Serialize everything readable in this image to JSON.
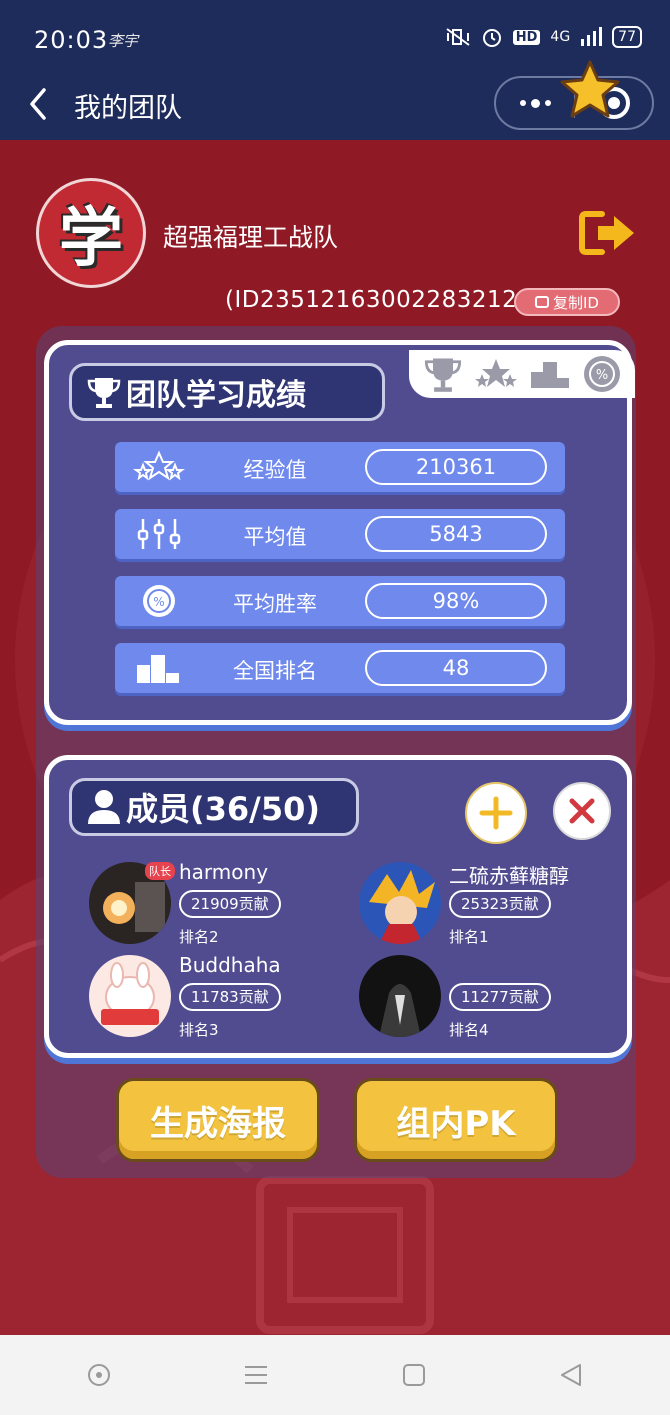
{
  "status_bar": {
    "time": "20:03",
    "signature": "李宇",
    "network": "4G",
    "hd": "HD",
    "battery": "77"
  },
  "nav": {
    "title": "我的团队"
  },
  "team": {
    "name": "超强福理工战队",
    "logo_char": "学",
    "id_text": "(ID235121630022832128)",
    "copy_label": "复制ID"
  },
  "stats": {
    "title": "团队学习成绩",
    "rows": [
      {
        "label": "经验值",
        "value": "210361",
        "icon": "stars-icon"
      },
      {
        "label": "平均值",
        "value": "5843",
        "icon": "sliders-icon"
      },
      {
        "label": "平均胜率",
        "value": "98%",
        "icon": "percent-icon"
      },
      {
        "label": "全国排名",
        "value": "48",
        "icon": "podium-icon"
      }
    ],
    "tab_icons": [
      "trophy-icon",
      "stars-icon",
      "podium-icon",
      "percent-icon"
    ]
  },
  "members": {
    "title": "成员(36/50)",
    "leader_tag": "队长",
    "list": [
      {
        "name": "harmony",
        "contribution": "21909贡献",
        "rank": "排名2",
        "leader": true
      },
      {
        "name": "二硫赤藓糖醇",
        "contribution": "25323贡献",
        "rank": "排名1",
        "leader": false
      },
      {
        "name": "Buddhaha",
        "contribution": "11783贡献",
        "rank": "排名3",
        "leader": false
      },
      {
        "name": "",
        "contribution": "11277贡献",
        "rank": "排名4",
        "leader": false
      }
    ]
  },
  "actions": {
    "poster": "生成海报",
    "pk": "组内PK"
  },
  "colors": {
    "header_bg": "#1d2c5a",
    "page_bg": "#8f1a25",
    "card_bg": "#504c8f",
    "stat_row": "#6f89ec",
    "button_yellow": "#f3c340"
  }
}
